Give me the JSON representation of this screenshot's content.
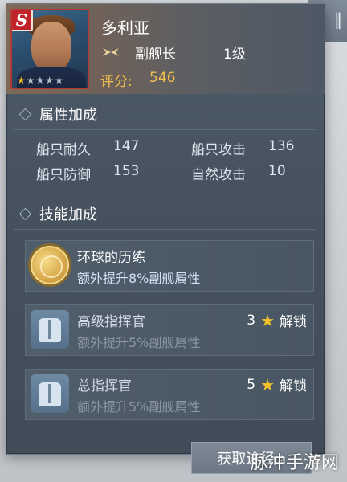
{
  "hero": {
    "rank_badge": "S",
    "name": "多利亚",
    "role": "副舰长",
    "level": "1级",
    "score_label": "评分:",
    "score_value": "546",
    "stars_filled": 1,
    "stars_total": 5
  },
  "sections": {
    "attributes_title": "属性加成",
    "skills_title": "技能加成"
  },
  "stats": [
    {
      "label": "船只耐久",
      "value": "147"
    },
    {
      "label": "船只攻击",
      "value": "136"
    },
    {
      "label": "船只防御",
      "value": "153"
    },
    {
      "label": "自然攻击",
      "value": "10"
    }
  ],
  "skills": [
    {
      "title": "环球的历练",
      "desc": "额外提升8%副舰属性",
      "icon": "globe-icon",
      "unlock_value": "",
      "unlock_text": ""
    },
    {
      "title": "高级指挥官",
      "desc": "额外提升5%副舰属性",
      "icon": "jacket-icon",
      "unlock_value": "3",
      "unlock_text": "解锁"
    },
    {
      "title": "总指挥官",
      "desc": "额外提升5%副舰属性",
      "icon": "jacket-icon",
      "unlock_value": "5",
      "unlock_text": "解锁"
    }
  ],
  "cta": {
    "label": "获取途径"
  },
  "watermark": "脉冲手游网",
  "colors": {
    "panel": "#46525f",
    "accent_gold": "#f1c04f",
    "skill_desc_blue": "#cfe2f5",
    "rank_red": "#c0242a"
  }
}
